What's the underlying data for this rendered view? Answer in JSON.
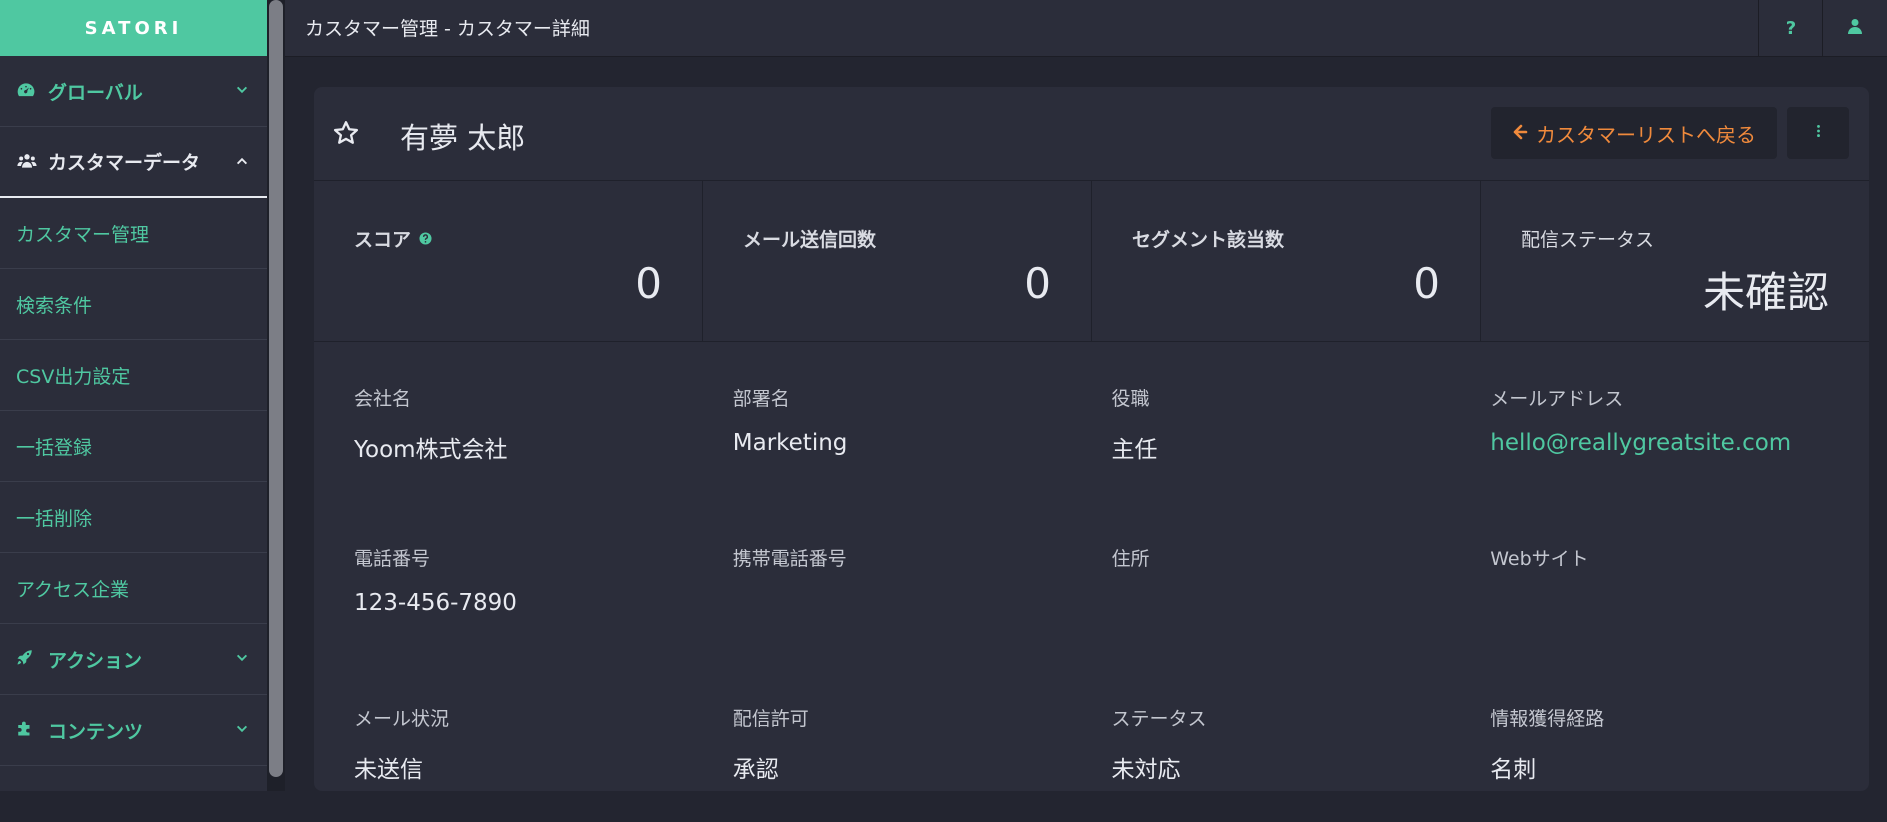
{
  "app": {
    "logo": "SATORI"
  },
  "sidebar": {
    "global": {
      "label": "グローバル"
    },
    "customer_data": {
      "label": "カスタマーデータ"
    },
    "sub_items": [
      {
        "label": "カスタマー管理"
      },
      {
        "label": "検索条件"
      },
      {
        "label": "CSV出力設定"
      },
      {
        "label": "一括登録"
      },
      {
        "label": "一括削除"
      },
      {
        "label": "アクセス企業"
      }
    ],
    "action": {
      "label": "アクション"
    },
    "contents": {
      "label": "コンテンツ"
    }
  },
  "topbar": {
    "breadcrumb": "カスタマー管理 - カスタマー詳細",
    "help_label": "?"
  },
  "customer": {
    "name": "有夢 太郎",
    "back_label": "カスタマーリストへ戻る"
  },
  "stats": [
    {
      "label": "スコア",
      "value": "0"
    },
    {
      "label": "メール送信回数",
      "value": "0"
    },
    {
      "label": "セグメント該当数",
      "value": "0"
    },
    {
      "label": "配信ステータス",
      "value": "未確認"
    }
  ],
  "fields": [
    {
      "label": "会社名",
      "value": "Yoom株式会社"
    },
    {
      "label": "部署名",
      "value": "Marketing"
    },
    {
      "label": "役職",
      "value": "主任"
    },
    {
      "label": "メールアドレス",
      "value": "hello@reallygreatsite.com"
    },
    {
      "label": "電話番号",
      "value": "123-456-7890"
    },
    {
      "label": "携帯電話番号",
      "value": ""
    },
    {
      "label": "住所",
      "value": ""
    },
    {
      "label": "Webサイト",
      "value": ""
    },
    {
      "label": "メール状況",
      "value": "未送信"
    },
    {
      "label": "配信許可",
      "value": "承認"
    },
    {
      "label": "ステータス",
      "value": "未対応"
    },
    {
      "label": "情報獲得経路",
      "value": "名刺"
    }
  ],
  "colors": {
    "accent": "#4fc8a1",
    "back_button_text": "#f08a3c",
    "background": "#232530",
    "panel": "#2b2d3a"
  }
}
